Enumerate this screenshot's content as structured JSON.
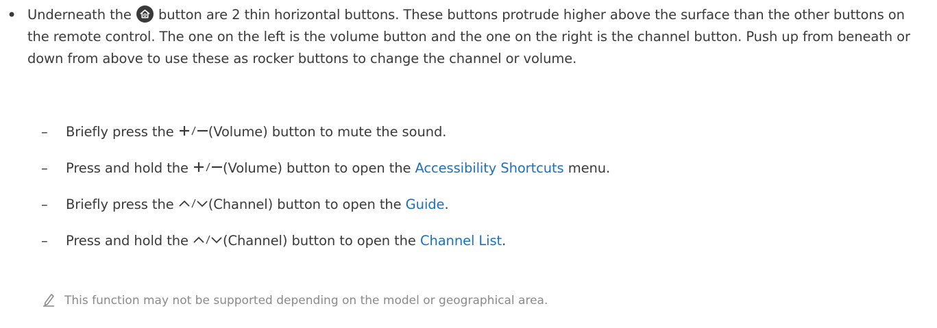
{
  "main_bullet": {
    "text_before_icon": "Underneath the",
    "text_after_icon": "button are 2 thin horizontal buttons. These buttons protrude higher above the surface than the other buttons on the remote control. The one on the left is the volume button and the one on the right is the channel button. Push up from beneath or down from above to use these as rocker buttons to change the channel or volume.",
    "icon": "home-icon"
  },
  "sub_items": [
    {
      "before": "Briefly press the",
      "glyph": "+/−",
      "after": "(Volume) button to mute the sound.",
      "link": "",
      "tail": ""
    },
    {
      "before": "Press and hold the",
      "glyph": "+/−",
      "after": "(Volume) button to open the ",
      "link": "Accessibility Shortcuts",
      "tail": " menu."
    },
    {
      "before": "Briefly press the",
      "glyph": "∧/∨",
      "after": "(Channel) button to open the ",
      "link": "Guide",
      "tail": "."
    },
    {
      "before": "Press and hold the",
      "glyph": "∧/∨",
      "after": "(Channel) button to open the ",
      "link": "Channel List",
      "tail": "."
    }
  ],
  "note": {
    "icon": "pencil-note-icon",
    "text": "This function may not be supported depending on the model or geographical area."
  },
  "colors": {
    "text": "#3a3a3a",
    "link": "#1a70c6",
    "note": "#8a8a8a"
  }
}
